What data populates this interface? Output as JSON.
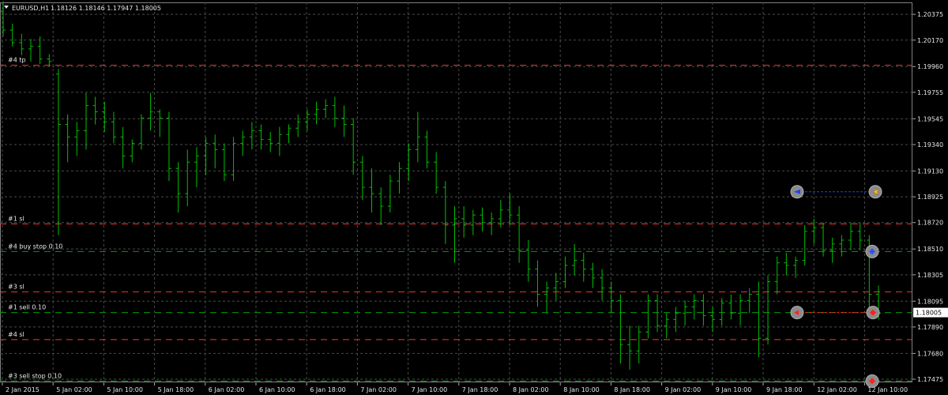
{
  "header": {
    "menu_icon": "triangle-down-icon",
    "symbol": "EURUSD,H1",
    "ohlc": "1.18126 1.18146 1.17947 1.18005"
  },
  "colors": {
    "background": "#000000",
    "grid": "#4a4a4a",
    "candle": "#00c000",
    "sl_tp_line": "#ff3030",
    "pending_line": "#00a000",
    "axis_text": "#e6e6e6",
    "price_box_bg": "#ffffff",
    "price_box_text": "#000000"
  },
  "chart_data": {
    "type": "line",
    "title": "EURUSD,H1",
    "price_axis": {
      "ticks": [
        "1.20375",
        "1.20170",
        "1.19960",
        "1.19755",
        "1.19545",
        "1.19340",
        "1.19130",
        "1.18925",
        "1.18720",
        "1.18510",
        "1.18305",
        "1.18095",
        "1.17890",
        "1.17680",
        "1.17475"
      ],
      "ylim": [
        1.1745,
        1.2047
      ],
      "current_price": "1.18005"
    },
    "time_axis": {
      "ticks": [
        "2 Jan 2015",
        "5 Jan 02:00",
        "5 Jan 10:00",
        "5 Jan 18:00",
        "6 Jan 02:00",
        "6 Jan 10:00",
        "6 Jan 18:00",
        "7 Jan 02:00",
        "7 Jan 10:00",
        "7 Jan 18:00",
        "8 Jan 02:00",
        "8 Jan 10:00",
        "8 Jan 18:00",
        "9 Jan 02:00",
        "9 Jan 10:00",
        "9 Jan 18:00",
        "12 Jan 02:00",
        "12 Jan 10:00"
      ]
    },
    "order_lines": [
      {
        "label": "#4 tp",
        "price": 1.1997,
        "kind": "sl_tp"
      },
      {
        "label": "#1 sl",
        "price": 1.1871,
        "kind": "sl_tp"
      },
      {
        "label": "#4 buy stop 0.10",
        "price": 1.1849,
        "kind": "pending"
      },
      {
        "label": "#3 sl",
        "price": 1.1817,
        "kind": "sl_tp"
      },
      {
        "label": "#1 sell 0.10",
        "price": 1.18005,
        "kind": "pending"
      },
      {
        "label": "#4 sl",
        "price": 1.1779,
        "kind": "sl_tp"
      },
      {
        "label": "#3 sell stop 0.10",
        "price": 1.1746,
        "kind": "pending"
      }
    ],
    "candles": [
      [
        1.204,
        1.2048,
        1.202,
        1.2025
      ],
      [
        1.2025,
        1.203,
        1.2012,
        1.2015
      ],
      [
        1.2015,
        1.2022,
        1.2005,
        1.201
      ],
      [
        1.201,
        1.2018,
        1.2,
        1.2012
      ],
      [
        1.2012,
        1.202,
        1.1998,
        1.2002
      ],
      [
        1.2002,
        1.2006,
        1.1996,
        1.2
      ],
      [
        1.199,
        1.1994,
        1.1862,
        1.195
      ],
      [
        1.195,
        1.1958,
        1.192,
        1.194
      ],
      [
        1.194,
        1.1952,
        1.1925,
        1.1945
      ],
      [
        1.1945,
        1.1975,
        1.193,
        1.1965
      ],
      [
        1.1965,
        1.1972,
        1.195,
        1.196
      ],
      [
        1.196,
        1.1968,
        1.1944,
        1.1952
      ],
      [
        1.1952,
        1.196,
        1.1935,
        1.194
      ],
      [
        1.194,
        1.1948,
        1.1915,
        1.1925
      ],
      [
        1.1925,
        1.1938,
        1.192,
        1.1935
      ],
      [
        1.1935,
        1.1958,
        1.193,
        1.1955
      ],
      [
        1.1955,
        1.1975,
        1.1945,
        1.196
      ],
      [
        1.196,
        1.1962,
        1.194,
        1.1955
      ],
      [
        1.1955,
        1.196,
        1.1905,
        1.1915
      ],
      [
        1.1915,
        1.192,
        1.188,
        1.1895
      ],
      [
        1.1895,
        1.193,
        1.1885,
        1.192
      ],
      [
        1.192,
        1.1932,
        1.19,
        1.1925
      ],
      [
        1.1925,
        1.194,
        1.191,
        1.1935
      ],
      [
        1.1935,
        1.1942,
        1.1915,
        1.193
      ],
      [
        1.193,
        1.1935,
        1.1905,
        1.191
      ],
      [
        1.191,
        1.194,
        1.1905,
        1.1935
      ],
      [
        1.1935,
        1.1945,
        1.1925,
        1.194
      ],
      [
        1.194,
        1.1952,
        1.193,
        1.1945
      ],
      [
        1.1945,
        1.195,
        1.193,
        1.1938
      ],
      [
        1.1938,
        1.1944,
        1.1928,
        1.1935
      ],
      [
        1.1935,
        1.1948,
        1.1925,
        1.1942
      ],
      [
        1.1942,
        1.195,
        1.1935,
        1.1947
      ],
      [
        1.1947,
        1.1958,
        1.194,
        1.1952
      ],
      [
        1.1952,
        1.1962,
        1.1945,
        1.1958
      ],
      [
        1.1958,
        1.1968,
        1.195,
        1.1962
      ],
      [
        1.1962,
        1.197,
        1.1955,
        1.1965
      ],
      [
        1.1965,
        1.1972,
        1.1948,
        1.1955
      ],
      [
        1.1955,
        1.1965,
        1.194,
        1.195
      ],
      [
        1.195,
        1.1955,
        1.191,
        1.192
      ],
      [
        1.192,
        1.1925,
        1.189,
        1.19
      ],
      [
        1.19,
        1.1915,
        1.188,
        1.1895
      ],
      [
        1.1895,
        1.19,
        1.187,
        1.1885
      ],
      [
        1.1885,
        1.191,
        1.188,
        1.1905
      ],
      [
        1.1905,
        1.192,
        1.1895,
        1.1915
      ],
      [
        1.1915,
        1.1935,
        1.1905,
        1.193
      ],
      [
        1.193,
        1.196,
        1.192,
        1.194
      ],
      [
        1.194,
        1.1945,
        1.1915,
        1.192
      ],
      [
        1.192,
        1.1928,
        1.1895,
        1.19
      ],
      [
        1.19,
        1.1905,
        1.1855,
        1.187
      ],
      [
        1.187,
        1.1885,
        1.184,
        1.1875
      ],
      [
        1.1875,
        1.1885,
        1.186,
        1.187
      ],
      [
        1.187,
        1.1882,
        1.1862,
        1.1878
      ],
      [
        1.1878,
        1.1884,
        1.1865,
        1.1872
      ],
      [
        1.1872,
        1.188,
        1.1862,
        1.1875
      ],
      [
        1.1875,
        1.189,
        1.1868,
        1.1882
      ],
      [
        1.1882,
        1.1895,
        1.187,
        1.1878
      ],
      [
        1.1878,
        1.1885,
        1.184,
        1.185
      ],
      [
        1.185,
        1.1858,
        1.1825,
        1.1835
      ],
      [
        1.1835,
        1.1842,
        1.1805,
        1.1815
      ],
      [
        1.1815,
        1.1825,
        1.18,
        1.182
      ],
      [
        1.182,
        1.1832,
        1.181,
        1.1825
      ],
      [
        1.1825,
        1.1845,
        1.182,
        1.1838
      ],
      [
        1.1838,
        1.1855,
        1.183,
        1.1842
      ],
      [
        1.1842,
        1.1848,
        1.1825,
        1.1835
      ],
      [
        1.1835,
        1.184,
        1.182,
        1.1828
      ],
      [
        1.1828,
        1.1835,
        1.181,
        1.182
      ],
      [
        1.182,
        1.1825,
        1.18,
        1.181
      ],
      [
        1.181,
        1.1815,
        1.176,
        1.1775
      ],
      [
        1.1775,
        1.179,
        1.1755,
        1.177
      ],
      [
        1.177,
        1.179,
        1.176,
        1.1785
      ],
      [
        1.1785,
        1.1815,
        1.178,
        1.181
      ],
      [
        1.181,
        1.1815,
        1.1785,
        1.179
      ],
      [
        1.179,
        1.18,
        1.178,
        1.1795
      ],
      [
        1.1795,
        1.1805,
        1.1785,
        1.18
      ],
      [
        1.18,
        1.181,
        1.179,
        1.1805
      ],
      [
        1.1805,
        1.1815,
        1.1795,
        1.181
      ],
      [
        1.181,
        1.1815,
        1.179,
        1.1798
      ],
      [
        1.1798,
        1.1805,
        1.1785,
        1.1795
      ],
      [
        1.1795,
        1.1812,
        1.179,
        1.1808
      ],
      [
        1.1808,
        1.1815,
        1.1795,
        1.18
      ],
      [
        1.18,
        1.1815,
        1.179,
        1.181
      ],
      [
        1.181,
        1.182,
        1.18,
        1.1815
      ],
      [
        1.1815,
        1.1825,
        1.1765,
        1.178
      ],
      [
        1.178,
        1.183,
        1.1775,
        1.1825
      ],
      [
        1.1825,
        1.1845,
        1.1815,
        1.184
      ],
      [
        1.184,
        1.1848,
        1.183,
        1.1838
      ],
      [
        1.1838,
        1.1845,
        1.1828,
        1.1842
      ],
      [
        1.1842,
        1.187,
        1.1838,
        1.1865
      ],
      [
        1.1865,
        1.1875,
        1.1855,
        1.1868
      ],
      [
        1.1868,
        1.1872,
        1.1845,
        1.185
      ],
      [
        1.185,
        1.186,
        1.184,
        1.1855
      ],
      [
        1.1855,
        1.1862,
        1.1845,
        1.1858
      ],
      [
        1.1858,
        1.1872,
        1.185,
        1.1865
      ],
      [
        1.1865,
        1.1872,
        1.185,
        1.1858
      ],
      [
        1.1858,
        1.1862,
        1.18,
        1.1815
      ],
      [
        1.1815,
        1.1822,
        1.1795,
        1.18
      ]
    ]
  }
}
